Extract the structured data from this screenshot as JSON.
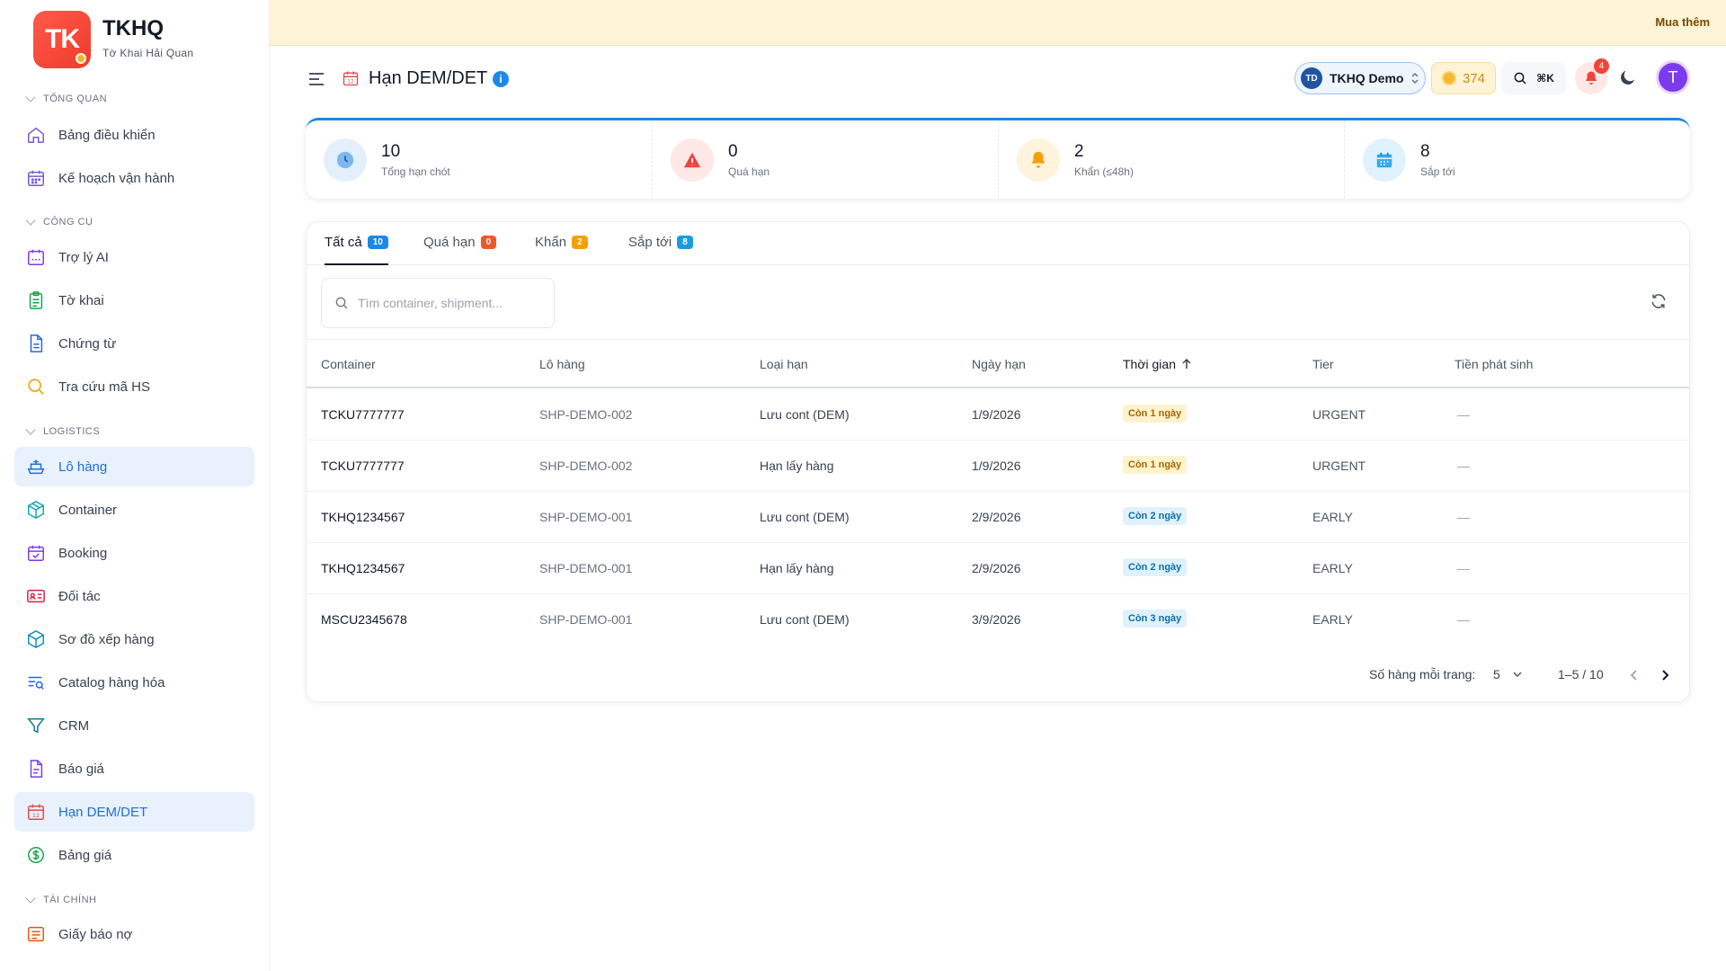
{
  "brand": {
    "logo": "TK",
    "name": "TKHQ",
    "sub": "Tờ Khai Hải Quan"
  },
  "sidebar": {
    "sections": [
      {
        "label": "TỔNG QUAN",
        "items": [
          {
            "label": "Bảng điều khiển",
            "icon": "home-icon"
          },
          {
            "label": "Kế hoạch vận hành",
            "icon": "calendar-icon"
          }
        ]
      },
      {
        "label": "CÔNG CỤ",
        "items": [
          {
            "label": "Trợ lý AI",
            "icon": "robot-icon"
          },
          {
            "label": "Tờ khai",
            "icon": "clipboard-icon"
          },
          {
            "label": "Chứng từ",
            "icon": "document-icon"
          },
          {
            "label": "Tra cứu mã HS",
            "icon": "search-icon"
          }
        ]
      },
      {
        "label": "LOGISTICS",
        "items": [
          {
            "label": "Lô hàng",
            "icon": "ship-icon"
          },
          {
            "label": "Container",
            "icon": "box-icon"
          },
          {
            "label": "Booking",
            "icon": "calendar-check-icon"
          },
          {
            "label": "Đối tác",
            "icon": "id-card-icon"
          },
          {
            "label": "Sơ đồ xếp hàng",
            "icon": "cube-icon"
          },
          {
            "label": "Catalog hàng hóa",
            "icon": "list-search-icon"
          },
          {
            "label": "CRM",
            "icon": "funnel-icon"
          },
          {
            "label": "Báo giá",
            "icon": "file-icon"
          },
          {
            "label": "Hạn DEM/DET",
            "icon": "calendar-12-icon"
          },
          {
            "label": "Bảng giá",
            "icon": "dollar-circle-icon"
          }
        ]
      },
      {
        "label": "TÀI CHÍNH",
        "items": [
          {
            "label": "Giấy báo nợ",
            "icon": "receipt-icon"
          }
        ]
      }
    ]
  },
  "topbar": {
    "buy_label": "Mua thêm"
  },
  "header": {
    "title": "Hạn DEM/DET",
    "org_initials": "TD",
    "org_name": "TKHQ Demo",
    "coins": "374",
    "shortcut": "⌘K",
    "notifications": "4",
    "user_initial": "T"
  },
  "stats": [
    {
      "value": "10",
      "label": "Tổng hạn chót",
      "color": "#1e88e5",
      "bg": "#e3f0fc"
    },
    {
      "value": "0",
      "label": "Quá hạn",
      "color": "#ef4444",
      "bg": "#fde8e6"
    },
    {
      "value": "2",
      "label": "Khẩn (≤48h)",
      "color": "#f59e0b",
      "bg": "#fef3dc"
    },
    {
      "value": "8",
      "label": "Sắp tới",
      "color": "#0ea5e9",
      "bg": "#e0f2fe"
    }
  ],
  "tabs": [
    {
      "label": "Tất cả",
      "count": "10",
      "color": "#1e88e5"
    },
    {
      "label": "Quá hạn",
      "count": "0",
      "color": "#f0562b"
    },
    {
      "label": "Khẩn",
      "count": "2",
      "color": "#f5a000"
    },
    {
      "label": "Sắp tới",
      "count": "8",
      "color": "#1a9be0"
    }
  ],
  "search": {
    "placeholder": "Tìm container, shipment..."
  },
  "table": {
    "columns": [
      "Container",
      "Lô hàng",
      "Loại hạn",
      "Ngày hạn",
      "Thời gian",
      "Tier",
      "Tiền phát sinh"
    ],
    "rows": [
      {
        "container": "TCKU7777777",
        "shipment": "SHP-DEMO-002",
        "type": "Lưu cont (DEM)",
        "date": "1/9/2026",
        "time": "Còn 1 ngày",
        "tone": "warn",
        "tier": "URGENT",
        "fee": "—"
      },
      {
        "container": "TCKU7777777",
        "shipment": "SHP-DEMO-002",
        "type": "Hạn lấy hàng",
        "date": "1/9/2026",
        "time": "Còn 1 ngày",
        "tone": "warn",
        "tier": "URGENT",
        "fee": "—"
      },
      {
        "container": "TKHQ1234567",
        "shipment": "SHP-DEMO-001",
        "type": "Lưu cont (DEM)",
        "date": "2/9/2026",
        "time": "Còn 2 ngày",
        "tone": "info",
        "tier": "EARLY",
        "fee": "—"
      },
      {
        "container": "TKHQ1234567",
        "shipment": "SHP-DEMO-001",
        "type": "Hạn lấy hàng",
        "date": "2/9/2026",
        "time": "Còn 2 ngày",
        "tone": "info",
        "tier": "EARLY",
        "fee": "—"
      },
      {
        "container": "MSCU2345678",
        "shipment": "SHP-DEMO-001",
        "type": "Lưu cont (DEM)",
        "date": "3/9/2026",
        "time": "Còn 3 ngày",
        "tone": "info",
        "tier": "EARLY",
        "fee": "—"
      }
    ]
  },
  "pagination": {
    "rows_label": "Số hàng mỗi trang:",
    "rows_value": "5",
    "range": "1–5 / 10"
  }
}
